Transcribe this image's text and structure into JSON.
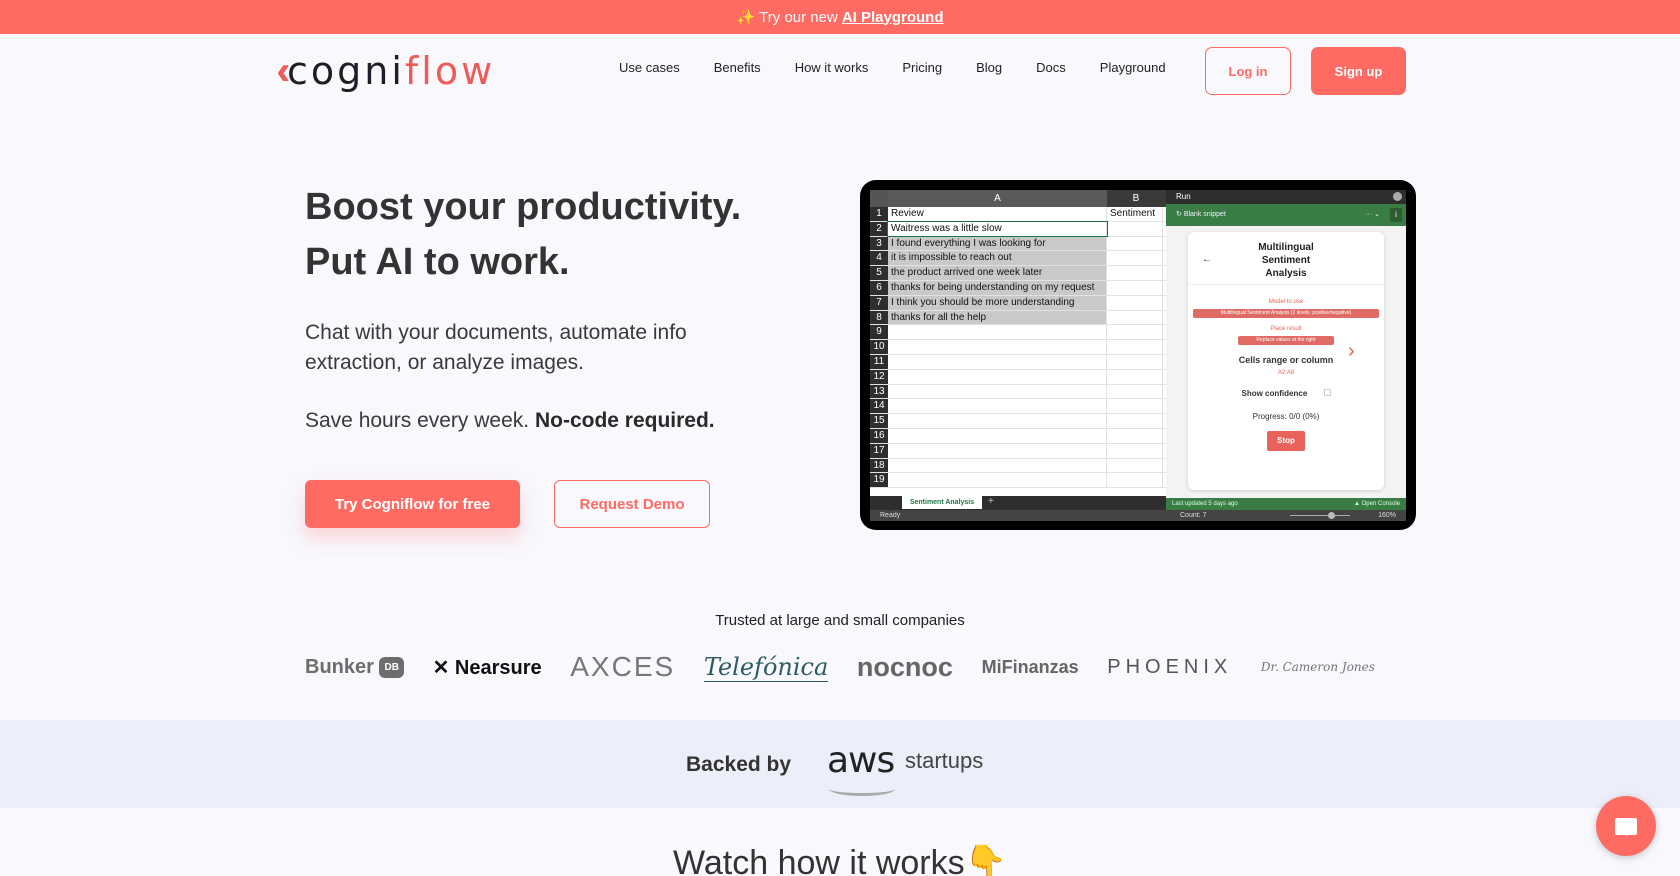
{
  "promo": {
    "sparkle_icon": "sparkles-icon",
    "text": "Try our new",
    "link": "AI Playground"
  },
  "nav": {
    "logo_text_a": "cogni",
    "logo_text_b": "flow",
    "logo_mark": "«",
    "links": [
      "Use cases",
      "Benefits",
      "How it works",
      "Pricing",
      "Blog",
      "Docs",
      "Playground"
    ],
    "login": "Log in",
    "signup": "Sign up"
  },
  "hero": {
    "title_line1": "Boost your productivity.",
    "title_line2": "Put AI to work.",
    "subtitle": "Chat with your documents, automate info extraction, or analyze images.",
    "tagline": "Save hours every week.",
    "tagline_bold": "No-code required.",
    "cta_primary": "Try Cogniflow for free",
    "cta_secondary": "Request Demo"
  },
  "spreadsheet": {
    "col_a": "A",
    "col_b": "B",
    "rows": [
      {
        "n": "1",
        "a": "Review",
        "b": "Sentiment"
      },
      {
        "n": "2",
        "a": "Waitress was a little slow",
        "b": ""
      },
      {
        "n": "3",
        "a": "I found everything I was looking for",
        "b": ""
      },
      {
        "n": "4",
        "a": "it is impossible to reach out",
        "b": ""
      },
      {
        "n": "5",
        "a": "the product arrived one week later",
        "b": ""
      },
      {
        "n": "6",
        "a": "thanks for being understanding on my request",
        "b": ""
      },
      {
        "n": "7",
        "a": "I think you should be more understanding",
        "b": ""
      },
      {
        "n": "8",
        "a": "thanks for all the help",
        "b": ""
      },
      {
        "n": "9",
        "a": "",
        "b": ""
      },
      {
        "n": "10",
        "a": "",
        "b": ""
      },
      {
        "n": "11",
        "a": "",
        "b": ""
      },
      {
        "n": "12",
        "a": "",
        "b": ""
      },
      {
        "n": "13",
        "a": "",
        "b": ""
      },
      {
        "n": "14",
        "a": "",
        "b": ""
      },
      {
        "n": "15",
        "a": "",
        "b": ""
      },
      {
        "n": "16",
        "a": "",
        "b": ""
      },
      {
        "n": "17",
        "a": "",
        "b": ""
      },
      {
        "n": "18",
        "a": "",
        "b": ""
      },
      {
        "n": "19",
        "a": "",
        "b": ""
      }
    ],
    "sheet_tab": "Sentiment Analysis",
    "add_sheet": "+",
    "status_ready": "Ready",
    "status_count": "Count: 7",
    "zoom_level": "160%",
    "pane": {
      "run_title": "Run",
      "snippet": "Blank snippet",
      "menu_dots": "··· ⌄",
      "info": "i",
      "card_title": "Multilingual Sentiment Analysis",
      "back_arrow": "←",
      "model_label": "Model to use",
      "model_value": "Multilingual Sentiment Analysis (2 levels: positive/negative)",
      "place_label": "Place result",
      "place_value": "Replace values at the right",
      "cells_label": "Cells range or column",
      "cells_value": "A2:A8",
      "show_confidence": "Show confidence",
      "progress": "Progress: 0/0 (0%)",
      "stop": "Stop",
      "last_updated": "Last updated 5 days ago",
      "open_console": "▲ Open Console"
    }
  },
  "trusted": {
    "heading": "Trusted at large and small companies",
    "logos": [
      "Bunker",
      "DB",
      "Nearsure",
      "AXCES",
      "Telefónica",
      "nocnoc",
      "MiFinanzas",
      "PHOENIX",
      "Dr. Cameron Jones"
    ]
  },
  "backed": {
    "label": "Backed by",
    "aws": "aws",
    "startups": "startups"
  },
  "watch": {
    "heading": "Watch how it works",
    "emoji": "👇"
  },
  "colors": {
    "brand": "#ff6b62",
    "excel_green": "#3a7d44",
    "text": "#333333"
  }
}
